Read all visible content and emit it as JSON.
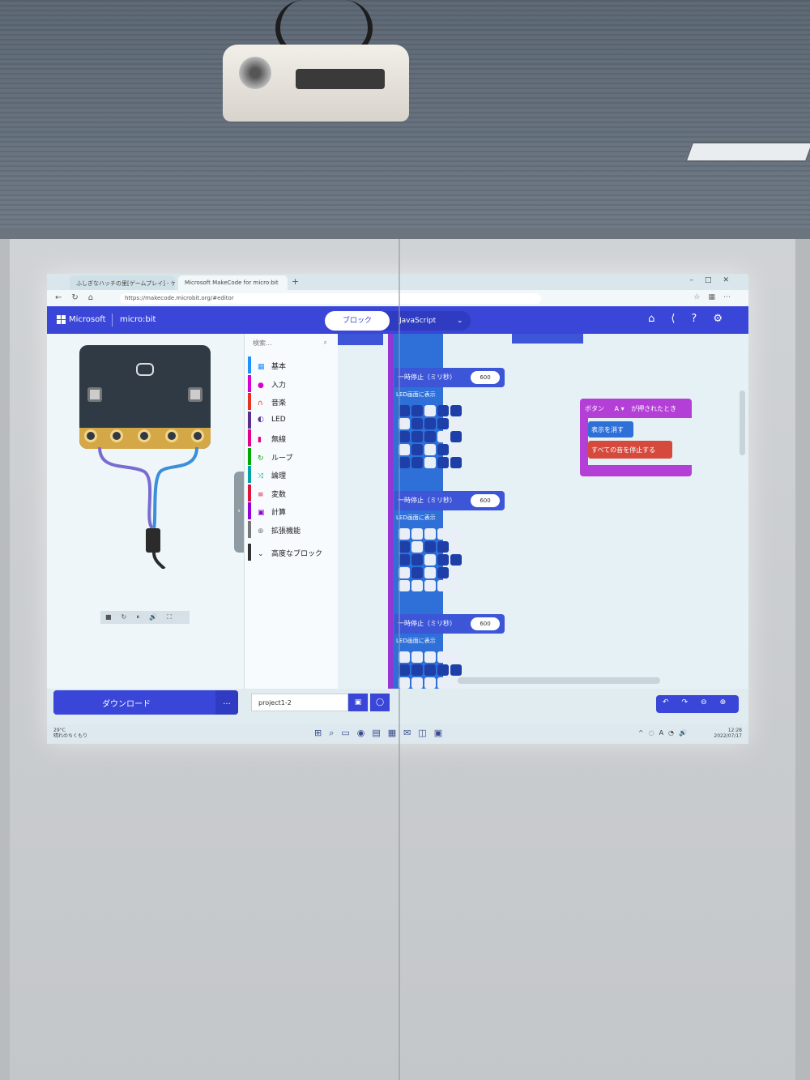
{
  "browser": {
    "tab_inactive": "ふしぎなハッチの里[ゲームプレイ] - ゲ",
    "tab_active": "Microsoft MakeCode for micro:bit",
    "url": "https://makecode.microbit.org/#editor"
  },
  "appbar": {
    "microsoft_label": "Microsoft",
    "microbit_label": "micro:bit",
    "blocks_label": "ブロック",
    "javascript_label": "JavaScript"
  },
  "toolbox": {
    "search_placeholder": "検索...",
    "items": [
      {
        "label": "基本",
        "icon": "grid-icon",
        "color": "#1e90ff"
      },
      {
        "label": "入力",
        "icon": "circle-icon",
        "color": "#d400d4"
      },
      {
        "label": "音楽",
        "icon": "headphones-icon",
        "color": "#e63022"
      },
      {
        "label": "LED",
        "icon": "toggle-icon",
        "color": "#5c2d91"
      },
      {
        "label": "無線",
        "icon": "signal-icon",
        "color": "#e3008c"
      },
      {
        "label": "ループ",
        "icon": "loop-icon",
        "color": "#00aa00"
      },
      {
        "label": "論理",
        "icon": "shuffle-icon",
        "color": "#00a4a6"
      },
      {
        "label": "変数",
        "icon": "list-icon",
        "color": "#dc143c"
      },
      {
        "label": "計算",
        "icon": "calculator-icon",
        "color": "#9400d3"
      },
      {
        "label": "拡張機能",
        "icon": "plus-circle-icon",
        "color": "#777777"
      },
      {
        "label": "高度なブロック",
        "icon": "chevron-down-icon",
        "color": "#333333"
      }
    ]
  },
  "workspace": {
    "pause_label": "一時停止（ミリ秒）",
    "pause_value": "600",
    "led_label": "LED画面に表示",
    "event_label": "ボタン",
    "event_button": "A",
    "event_suffix": "が押されたとき",
    "clear_label": "表示を消す",
    "stop_label": "すべての音を停止する"
  },
  "bottombar": {
    "download_label": "ダウンロード",
    "more_label": "...",
    "project_name": "project1-2"
  },
  "taskbar": {
    "temperature": "29°C",
    "weather": "晴れのちくもり",
    "time": "12:28",
    "date": "2022/07/17"
  },
  "colors": {
    "accent": "#3946d8",
    "event": "#b43fd6",
    "led": "#2e6fd8",
    "music": "#d64a3d"
  }
}
